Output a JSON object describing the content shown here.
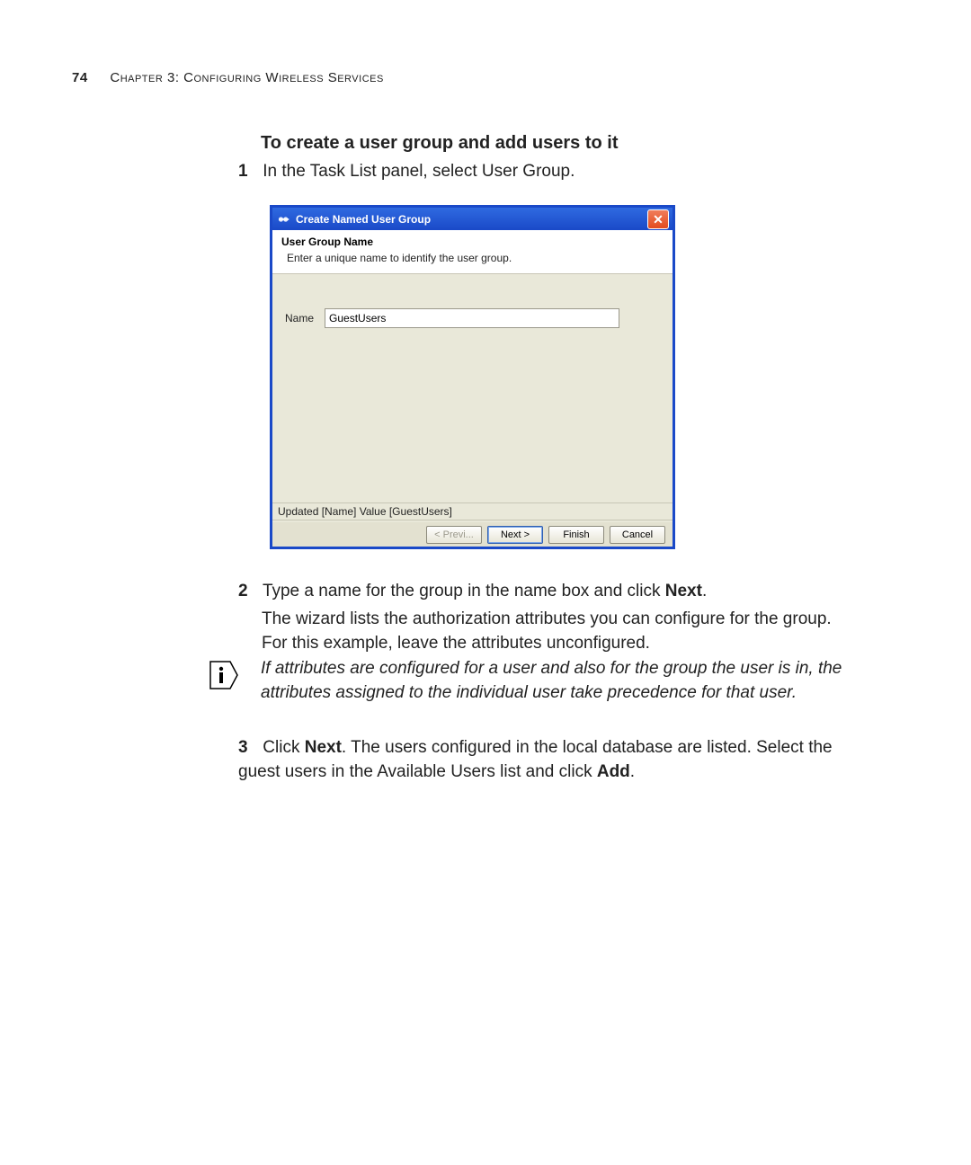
{
  "header": {
    "page_number": "74",
    "chapter_label": "Chapter 3: Configuring Wireless Services"
  },
  "section_title": "To create a user group and add users to it",
  "step1": {
    "num": "1",
    "text": "In the Task List panel, select User Group."
  },
  "dialog": {
    "title": "Create Named User Group",
    "header_title": "User Group Name",
    "header_sub": "Enter a unique name to identify the user group.",
    "field_label": "Name",
    "field_value": "GuestUsers",
    "status_text": "Updated [Name] Value [GuestUsers]",
    "buttons": {
      "prev": "< Previ...",
      "next": "Next >",
      "finish": "Finish",
      "cancel": "Cancel"
    }
  },
  "step2": {
    "num": "2",
    "line1_a": "Type a name for the group in the name box and click ",
    "line1_bold": "Next",
    "line1_b": ".",
    "line2": "The wizard lists the authorization attributes you can configure for the group. For this example, leave the attributes unconfigured."
  },
  "note": "If attributes are configured for a user and also for the group the user is in, the attributes assigned to the individual user take precedence for that user.",
  "step3": {
    "num": "3",
    "a": "Click ",
    "bold1": "Next",
    "b": ". The users configured in the local database are listed. Select the guest users in the Available Users list and click ",
    "bold2": "Add",
    "c": "."
  }
}
